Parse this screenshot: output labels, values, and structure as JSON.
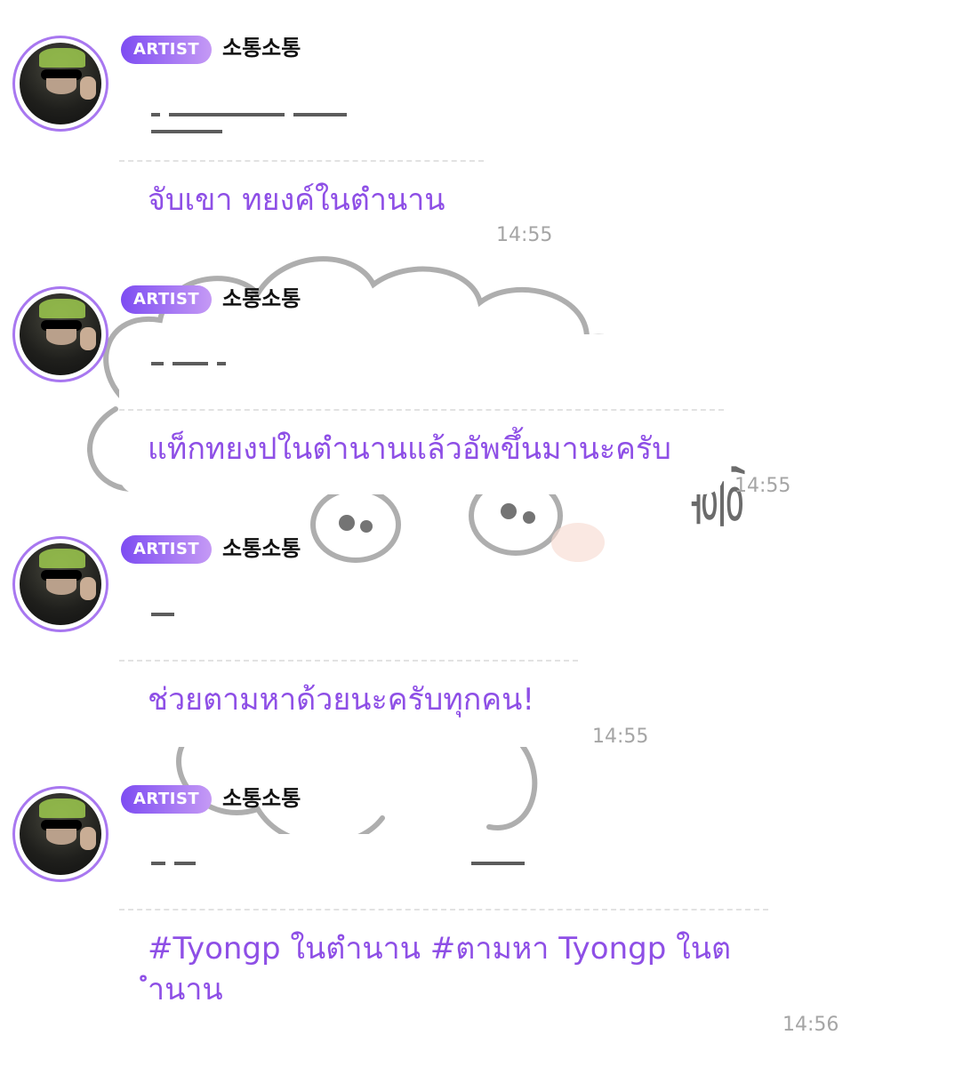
{
  "messages": [
    {
      "badge": "ARTIST",
      "name": "소통소통",
      "translation": "จับเขา ทยงค์ในตำนาน",
      "time": "14:55"
    },
    {
      "badge": "ARTIST",
      "name": "소통소통",
      "translation": "แท็กทยงปในตำนานแล้วอัพขึ้นมานะครับ",
      "time": "14:55"
    },
    {
      "badge": "ARTIST",
      "name": "소통소통",
      "translation": "ช่วยตามหาด้วยนะครับทุกคน!",
      "time": "14:55"
    },
    {
      "badge": "ARTIST",
      "name": "소통소통",
      "translation": "#Tyongp ในตำนาน #ตามหา Tyongp ในต\nำนาน",
      "time": "14:56"
    }
  ],
  "sticker": {
    "text": "흥,"
  },
  "colors": {
    "accent": "#8e4fe6",
    "badge_start": "#7d4cf2",
    "badge_end": "#c59af5",
    "time": "#a5a5a5"
  }
}
